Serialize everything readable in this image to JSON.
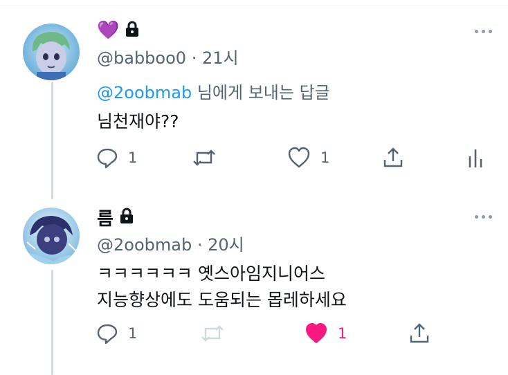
{
  "tweets": [
    {
      "display_name": "💜",
      "handle": "@babboo0",
      "separator": "·",
      "time": "21시",
      "reply_to_mention": "@2oobmab",
      "reply_to_suffix": " 님에게 보내는 답글",
      "body_lines": [
        "님천재야??"
      ],
      "reply_count": "1",
      "retweet_count": "",
      "like_count": "1",
      "liked": false
    },
    {
      "display_name": "름",
      "handle": "@2oobmab",
      "separator": "·",
      "time": "20시",
      "body_lines": [
        "ㅋㅋㅋㅋㅋㅋ 옛스아임지니어스",
        "지능향상에도 도움되는 몹레하세요"
      ],
      "reply_count": "1",
      "retweet_count": "",
      "like_count": "1",
      "liked": true
    }
  ],
  "colors": {
    "link": "#1d9bf0",
    "muted": "#536471",
    "like_active": "#f91880",
    "thread_line": "#cfd9de"
  },
  "icons": [
    "lock-icon",
    "more-icon",
    "reply-icon",
    "retweet-icon",
    "like-icon",
    "share-icon",
    "analytics-icon"
  ]
}
